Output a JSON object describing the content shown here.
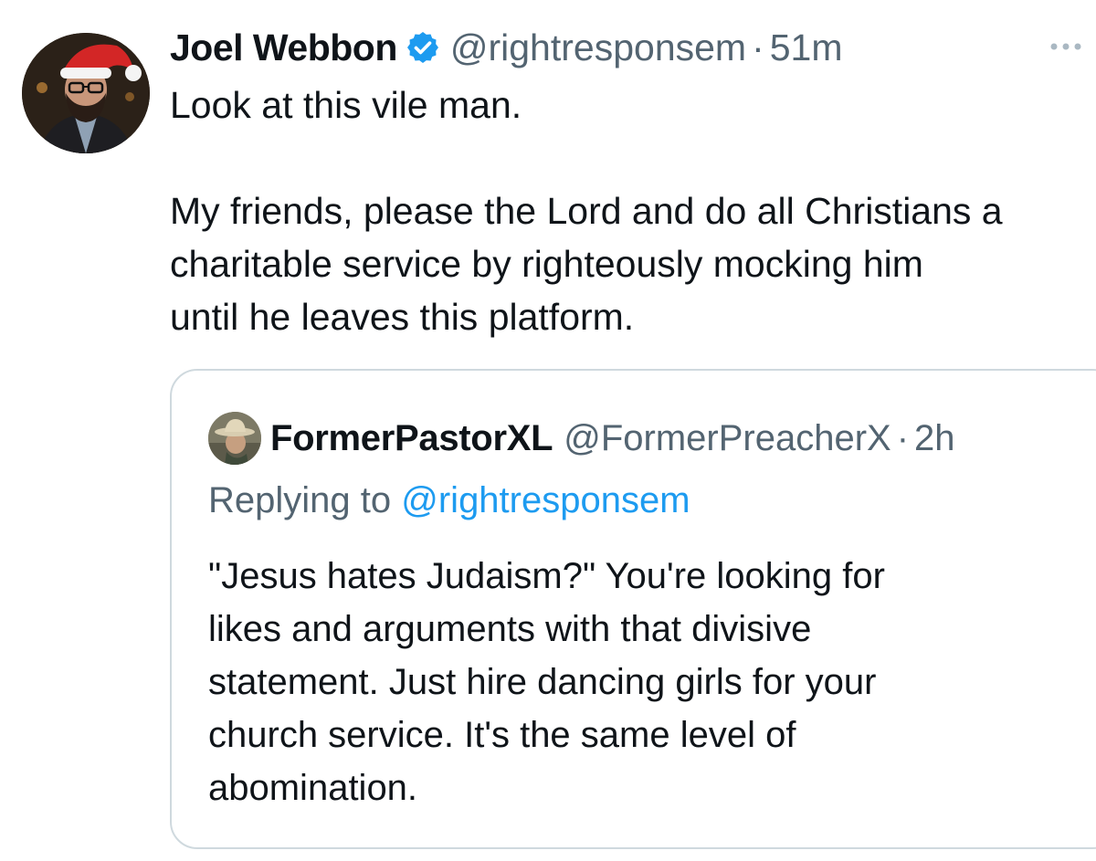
{
  "tweet": {
    "author": {
      "display_name": "Joel Webbon",
      "handle": "@rightresponsem",
      "verified": true,
      "avatar_icon": "santa-hat-avatar"
    },
    "separator": "·",
    "time": "51m",
    "more_icon": "more-options-icon",
    "text": "Look at this vile man.\n\nMy friends, please the Lord and do all Christians a\ncharitable service by righteously mocking him\nuntil he leaves this platform."
  },
  "quoted_tweet": {
    "author": {
      "display_name": "FormerPastorXL",
      "handle": "@FormerPreacherX",
      "avatar_icon": "cowboy-hat-avatar"
    },
    "separator": "·",
    "time": "2h",
    "replying_prefix": "Replying to",
    "replying_to": "@rightresponsem",
    "text": "\"Jesus hates Judaism?\" You're looking for\nlikes and arguments with that divisive\nstatement. Just hire dancing girls for your\nchurch service. It's the same level of\nabomination."
  },
  "colors": {
    "text_primary": "#0f1419",
    "text_secondary": "#536471",
    "link": "#1d9bf0",
    "verified": "#1d9bf0",
    "border": "#cfd9de"
  }
}
